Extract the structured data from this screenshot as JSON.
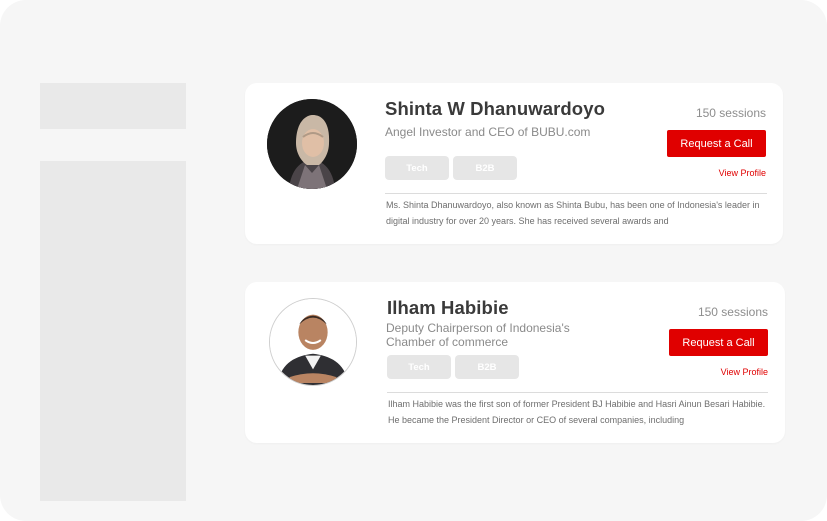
{
  "mentors": [
    {
      "name": "Shinta W Dhanuwardoyo",
      "role": "Angel Investor and CEO of BUBU.com",
      "tags": [
        "Tech",
        "B2B"
      ],
      "sessions": "150 sessions",
      "request_label": "Request a Call",
      "view_label": "View Profile",
      "bio": "Ms. Shinta Dhanuwardoyo, also known as Shinta Bubu, has been one of Indonesia's leader in digital industry for over 20 years. She has received several awards and"
    },
    {
      "name": "Ilham Habibie",
      "role": "Deputy Chairperson of Indonesia's Chamber of commerce",
      "tags": [
        "Tech",
        "B2B"
      ],
      "sessions": "150 sessions",
      "request_label": "Request a Call",
      "view_label": "View Profile",
      "bio": "Ilham Habibie was the first son of former President BJ Habibie and Hasri Ainun Besari Habibie. He became the President Director or CEO of several companies, including"
    }
  ],
  "colors": {
    "accent": "#e00000",
    "background": "#f6f6f6",
    "skeleton": "#e9e9e9",
    "tag_bg": "#e6e6e6"
  }
}
